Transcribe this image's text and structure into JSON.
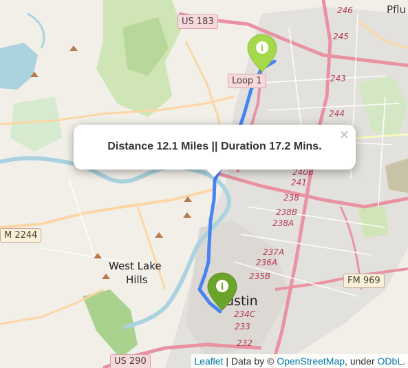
{
  "popup": {
    "text": "Distance 12.1 Miles || Duration 17.2 Mins.",
    "close_glyph": "×"
  },
  "markers": [
    {
      "name": "start",
      "color": "#a3d94a",
      "glyph": "i"
    },
    {
      "name": "end",
      "color": "#6ba32b",
      "glyph": "i"
    }
  ],
  "route_color": "#3b7cf0",
  "shields": {
    "us183": "US 183",
    "loop1": "Loop 1",
    "fm2244": "M 2244",
    "fm969": "FM 969",
    "us290": "US 290"
  },
  "exits": [
    "246",
    "245",
    "243",
    "244",
    "240B",
    "241",
    "238",
    "238B",
    "238A",
    "237A",
    "236A",
    "235B",
    "234C",
    "233",
    "232"
  ],
  "places": {
    "pflu": "Pflu",
    "west_lake_1": "West Lake",
    "west_lake_2": "Hills",
    "austin": "Austin"
  },
  "attribution": {
    "leaflet": "Leaflet",
    "sep1": " | Data by © ",
    "osm": "OpenStreetMap",
    "sep2": ", under ",
    "odbl": "ODbL",
    "end": "."
  }
}
